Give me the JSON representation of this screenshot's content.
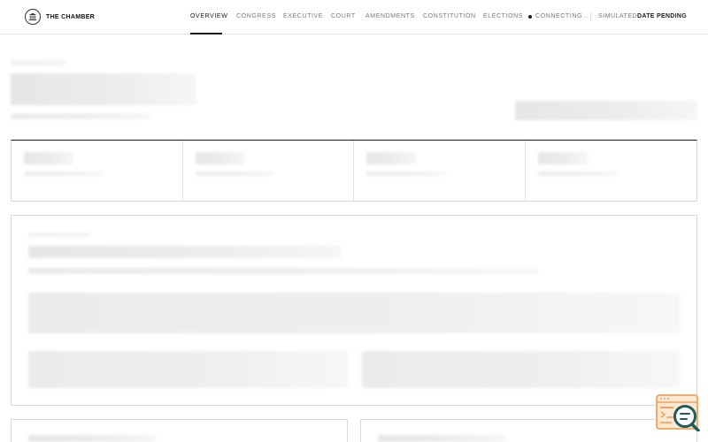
{
  "header": {
    "brand_name": "THE CHAMBER",
    "brand_icon": "capitol-building-icon",
    "nav": [
      {
        "label": "OVERVIEW",
        "active": true
      },
      {
        "label": "CONGRESS",
        "active": false
      },
      {
        "label": "EXECUTIVE",
        "active": false
      },
      {
        "label": "COURT",
        "active": false
      },
      {
        "label": "AMENDMENTS",
        "active": false
      },
      {
        "label": "CONSTITUTION",
        "active": false
      },
      {
        "label": "ELECTIONS",
        "active": false
      }
    ],
    "connection_status": "CONNECTING...",
    "simulated_label": "SIMULATED",
    "date_label": "DATE PENDING"
  },
  "colors": {
    "accent": "#1a1a1a",
    "muted_text": "#777777",
    "border": "#d8d8d8",
    "skeleton": "#ececec",
    "help_orange": "#f0a25a",
    "help_teal": "#1f5c5c"
  },
  "state": {
    "loading": true
  }
}
